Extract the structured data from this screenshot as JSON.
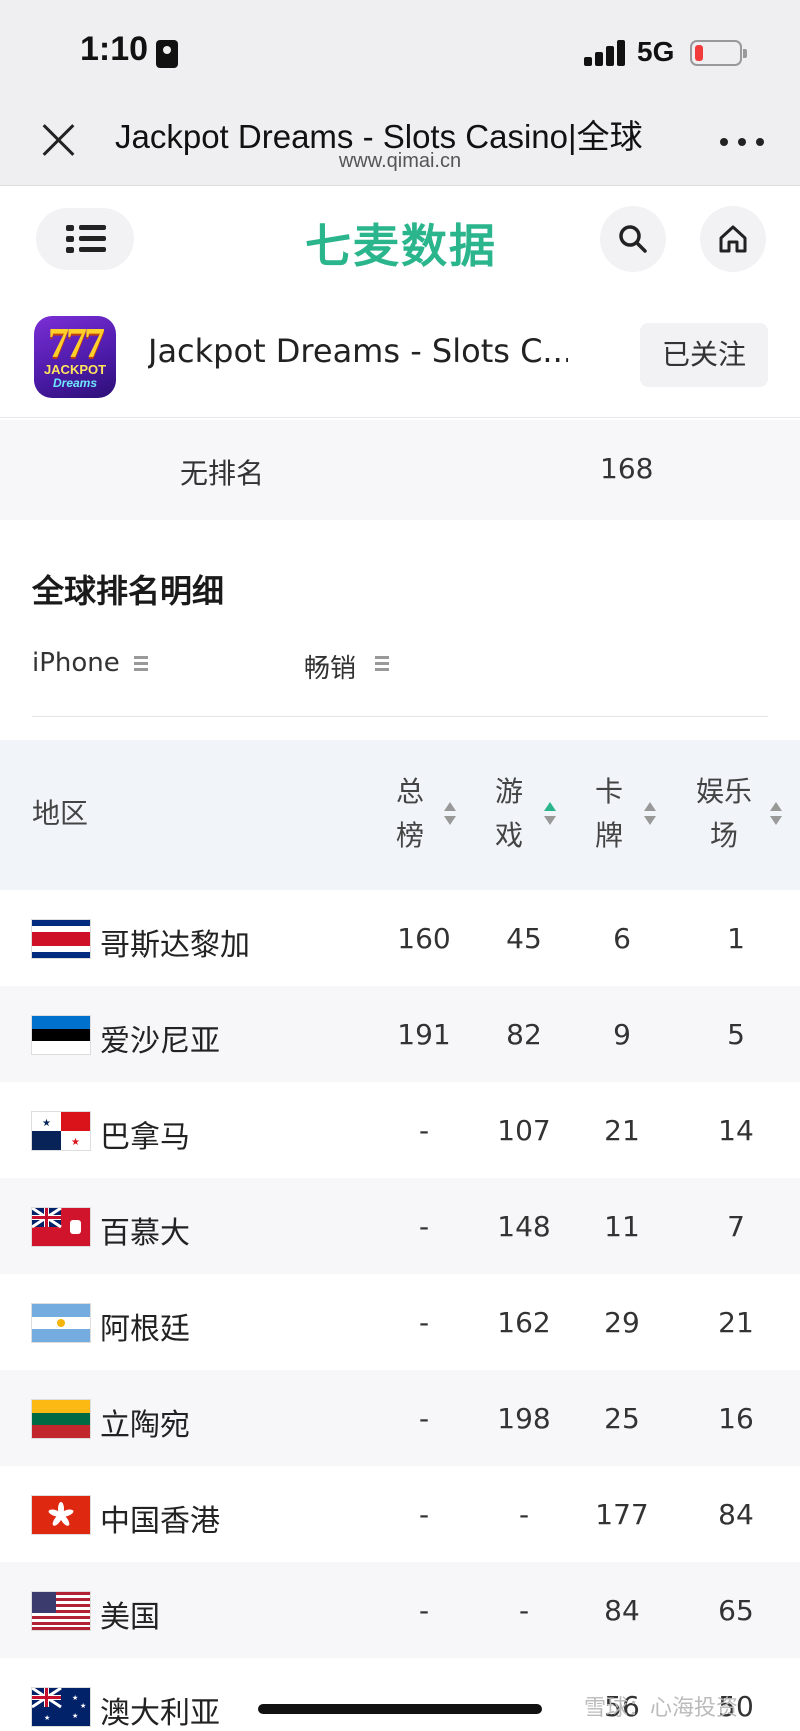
{
  "status": {
    "time": "1:10",
    "network": "5G"
  },
  "browser": {
    "title": "Jackpot Dreams - Slots Casino|全球",
    "url": "www.qimai.cn"
  },
  "site": {
    "logo": "七麦数据"
  },
  "app": {
    "name": "Jackpot Dreams - Slots C...",
    "icon_text": "777",
    "icon_word": "JACKPOT",
    "icon_word2": "Dreams",
    "follow_label": "已关注"
  },
  "norank": {
    "label": "无排名",
    "value": "168"
  },
  "section": {
    "title": "全球排名明细",
    "device_filter": "iPhone",
    "chart_filter": "畅销"
  },
  "table": {
    "headers": {
      "region": "地区",
      "total_1": "总",
      "total_2": "榜",
      "game_1": "游",
      "game_2": "戏",
      "card_1": "卡",
      "card_2": "牌",
      "ent_1": "娱乐",
      "ent_2": "场"
    },
    "rows": [
      {
        "region": "哥斯达黎加",
        "total": "160",
        "game": "45",
        "card": "6",
        "ent": "1"
      },
      {
        "region": "爱沙尼亚",
        "total": "191",
        "game": "82",
        "card": "9",
        "ent": "5"
      },
      {
        "region": "巴拿马",
        "total": "-",
        "game": "107",
        "card": "21",
        "ent": "14"
      },
      {
        "region": "百慕大",
        "total": "-",
        "game": "148",
        "card": "11",
        "ent": "7"
      },
      {
        "region": "阿根廷",
        "total": "-",
        "game": "162",
        "card": "29",
        "ent": "21"
      },
      {
        "region": "立陶宛",
        "total": "-",
        "game": "198",
        "card": "25",
        "ent": "16"
      },
      {
        "region": "中国香港",
        "total": "-",
        "game": "-",
        "card": "177",
        "ent": "84"
      },
      {
        "region": "美国",
        "total": "-",
        "game": "-",
        "card": "84",
        "ent": "65"
      },
      {
        "region": "澳大利亚",
        "total": "",
        "game": "",
        "card": "56",
        "ent": "50"
      }
    ]
  },
  "watermark": "雪球：心海投资"
}
